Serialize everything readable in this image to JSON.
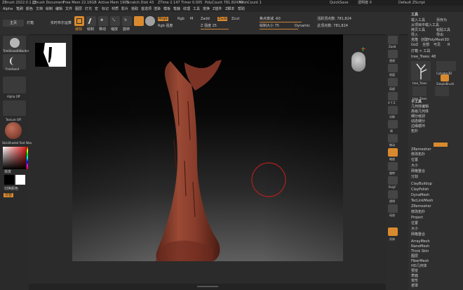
{
  "titlebar": {
    "items": [
      "ZBrush 2022.0.1 [],",
      "ZBrush Document",
      "Free Mem 22.16GB",
      "Active Mem 1903",
      "Scratch Disk 43",
      "ZTime 2.147 Timer 0.005",
      "PolyCount 781.824 KP",
      "MeshCount 1"
    ],
    "quicksave": "QuickSave",
    "seethrough": "透明度 0",
    "zscript": "Default ZScript"
  },
  "menubar": {
    "items": [
      "Alpha",
      "笔刷",
      "颜色",
      "文档",
      "绘制",
      "编辑",
      "文件",
      "图层",
      "灯光",
      "宏",
      "标记",
      "材质",
      "影片",
      "拾取",
      "首选项",
      "渲染",
      "模板",
      "笔触",
      "纹理",
      "工具",
      "变换",
      "Z插件",
      "Z脚本",
      "帮助"
    ]
  },
  "toolbar": {
    "home_label": "主页",
    "lightbox_label": "灯箱",
    "live_boolean_label": "实时布尔运算",
    "edit_label": "编辑",
    "draw_label": "绘制",
    "move_label": "移动",
    "scale_label": "缩放",
    "rotate_label": "旋转",
    "mrgb_label": "Mrgb",
    "rgb_label": "Rgb",
    "m_label": "M",
    "zadd_label": "Zadd",
    "zsub_label": "Zsub",
    "zcut_label": "Zcut",
    "rgb_intensity_label": "Rgb 强度",
    "z_intensity_label": "Z 强度 25",
    "focal_shift_label": "焦点衰减 -60",
    "draw_size_label": "绘制大小 75",
    "dynamic_label": "Dynamic",
    "active_points_label": "活跃顶点数: 781,824",
    "total_points_label": "总顶点数: 781,824",
    "focal_val": -60,
    "draw_size_val": 75,
    "z_intensity_val": 25
  },
  "leftpanel": {
    "brush_label": "TrimSmoothBorder",
    "stroke_label": "FreeHand",
    "alpha_label": "Alpha Off",
    "texture_label": "Texture Off",
    "material_label": "SkinShade4 Red Wax",
    "gradient_label": "渐变",
    "switch_color_label": "切换颜色",
    "alternate_label": "交替"
  },
  "rightshelf": {
    "labels": [
      "Zadd",
      "透视",
      "地面",
      "局部",
      "X Y Z",
      "对称",
      "帧",
      "移动",
      "缩放",
      "旋转",
      "PolyF",
      "透明",
      "动态",
      "实体"
    ]
  },
  "rightpanel": {
    "header": "工具",
    "top_buttons": [
      "载入工具",
      "另存为",
      "从项目中载入工具",
      "导出",
      "拷贝工具",
      "粘贴工具",
      "导入",
      "导出",
      "克隆",
      "创建PolyMesh3D",
      "GoZ",
      "全部",
      "可见",
      "R"
    ],
    "lightbox_tools_label": "灯箱 > 工具",
    "tool_name": "tree_Trees: 48",
    "tools": [
      "tree_Trees",
      "Cylinder3D",
      "SimpleBrush",
      "tree_Trees"
    ],
    "subtool_header": "子工具",
    "subtool_items": [
      "几何体编辑",
      "高级几何体",
      "细分级别",
      "动态细分",
      "边缘循环",
      "拓扑",
      "ZRemesher",
      "修改拓扑",
      "位置",
      "大小",
      "网格整合",
      "分割",
      "ArrayMesh",
      "NanoMesh",
      "Thick Skin",
      "图层",
      "FiberMesh",
      "HD几何体",
      "预览",
      "表面",
      "变形",
      "遮罩"
    ],
    "lower_items": [
      "ArrayMesh",
      "NanoMesh",
      "Thick Skin",
      "图层",
      "FiberMesh",
      "HD几何体",
      "预览",
      "表面",
      "变形",
      "遮罩"
    ],
    "subtool_rows": [
      "ClayBuildup",
      "ClayPolish",
      "DynaMesh",
      "TecLinkMesh",
      "ZRemesher",
      "修改拓扑",
      "Project",
      "位置",
      "大小",
      "网格整合"
    ]
  },
  "colors": {
    "accent": "#d98a2e",
    "tree": "#8a3a2a",
    "bg": "#2b2b2b"
  },
  "icons": [
    "home-icon",
    "lightbox-icon",
    "edit-icon",
    "draw-icon",
    "move-icon",
    "scale-icon",
    "rotate-icon",
    "head-icon",
    "axis-icon"
  ]
}
